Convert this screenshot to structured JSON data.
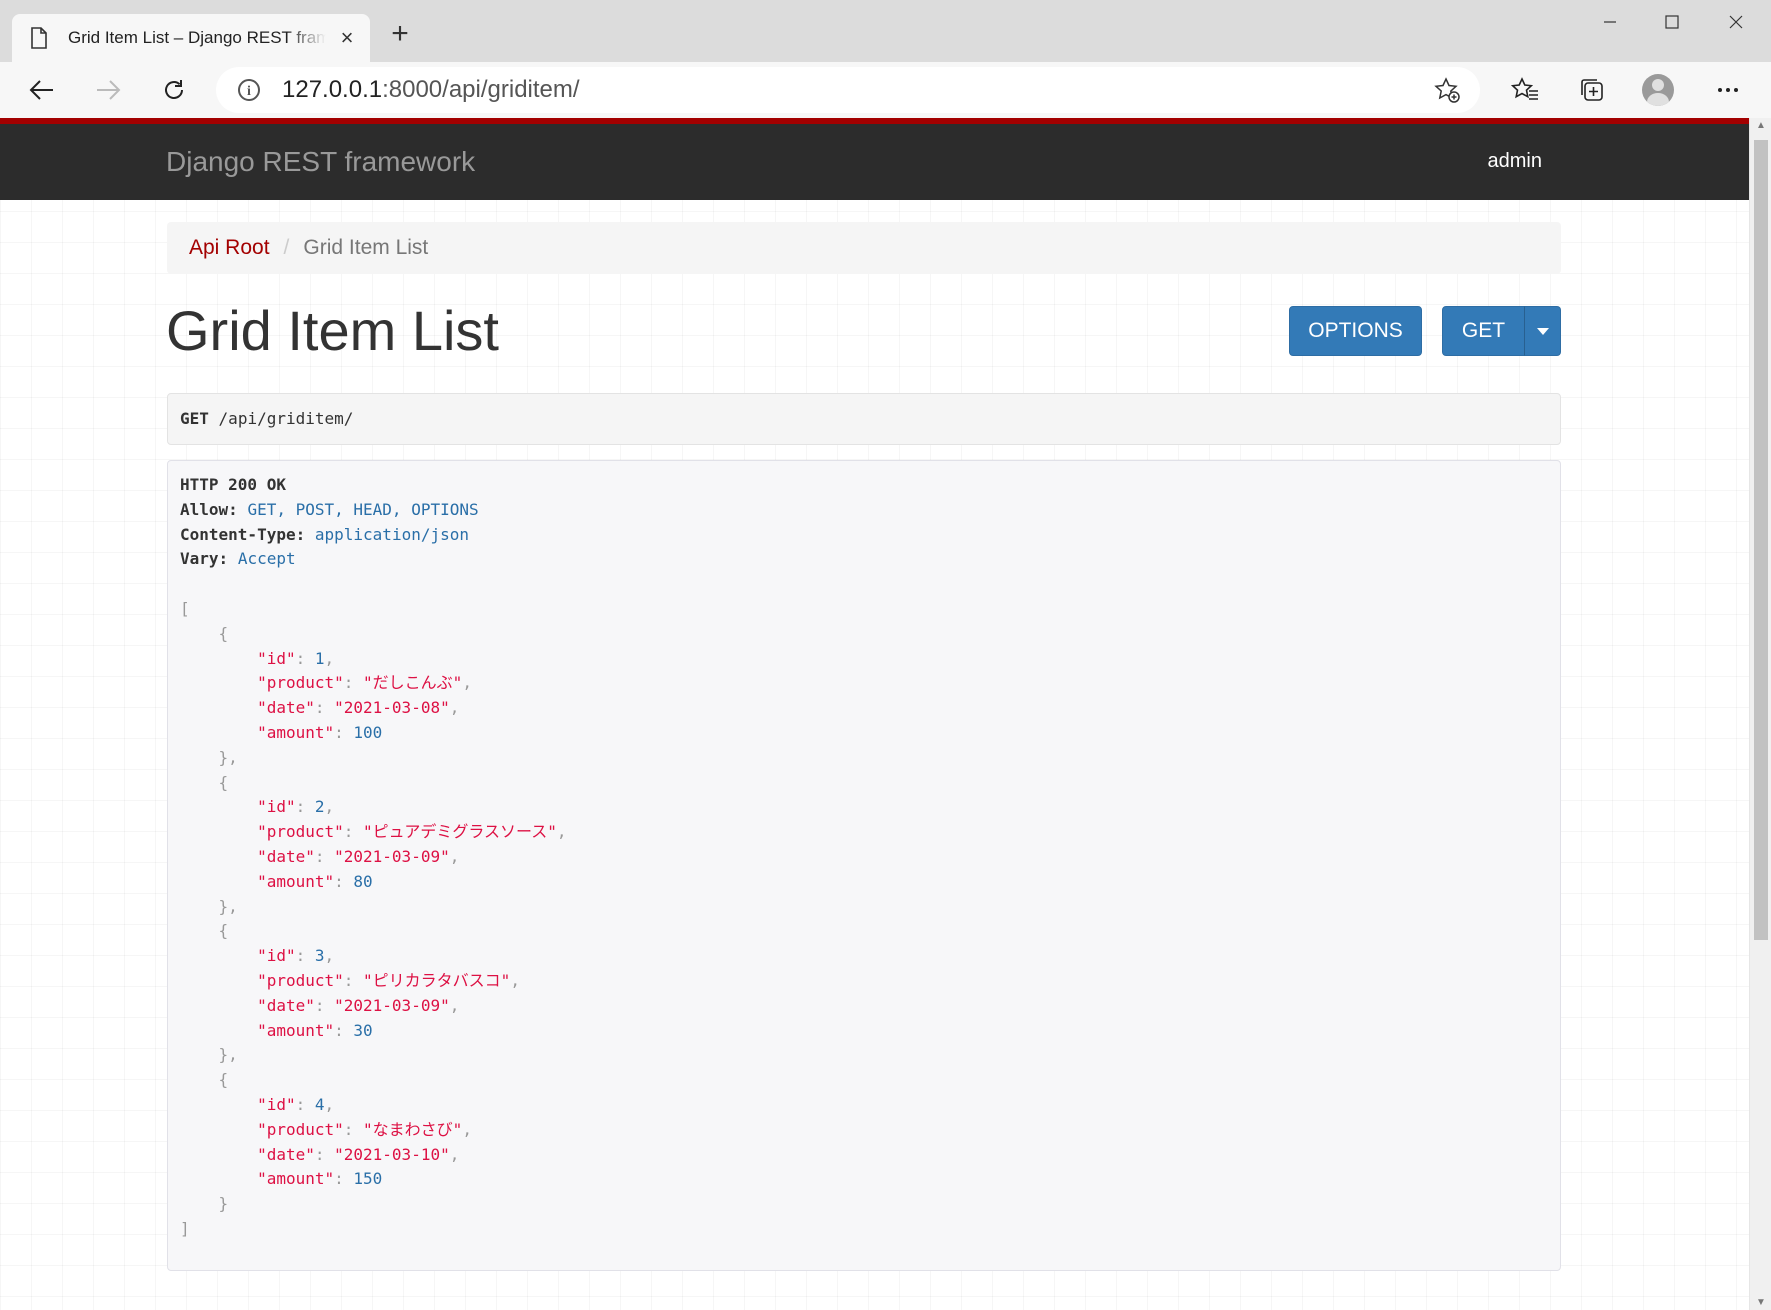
{
  "browser": {
    "tab_title": "Grid Item List – Django REST framework",
    "new_tab_symbol": "+",
    "url_host": "127.0.0.1",
    "url_rest": ":8000/api/griditem/"
  },
  "site": {
    "brand": "Django REST framework",
    "user": "admin"
  },
  "breadcrumb": {
    "root": "Api Root",
    "separator": "/",
    "current": "Grid Item List"
  },
  "page": {
    "title": "Grid Item List",
    "options_button": "OPTIONS",
    "get_button": "GET"
  },
  "request": {
    "method": "GET",
    "path": "/api/griditem/"
  },
  "response": {
    "status": "HTTP 200 OK",
    "headers": [
      {
        "name": "Allow:",
        "value": "GET, POST, HEAD, OPTIONS"
      },
      {
        "name": "Content-Type:",
        "value": "application/json"
      },
      {
        "name": "Vary:",
        "value": "Accept"
      }
    ],
    "items": [
      {
        "id": "1",
        "product": "\"だしこんぶ\"",
        "date": "\"2021-03-08\"",
        "amount": "100"
      },
      {
        "id": "2",
        "product": "\"ピュアデミグラスソース\"",
        "date": "\"2021-03-09\"",
        "amount": "80"
      },
      {
        "id": "3",
        "product": "\"ピリカラタバスコ\"",
        "date": "\"2021-03-09\"",
        "amount": "30"
      },
      {
        "id": "4",
        "product": "\"なまわさび\"",
        "date": "\"2021-03-10\"",
        "amount": "150"
      }
    ],
    "keys": {
      "id": "\"id\"",
      "product": "\"product\"",
      "date": "\"date\"",
      "amount": "\"amount\""
    }
  }
}
